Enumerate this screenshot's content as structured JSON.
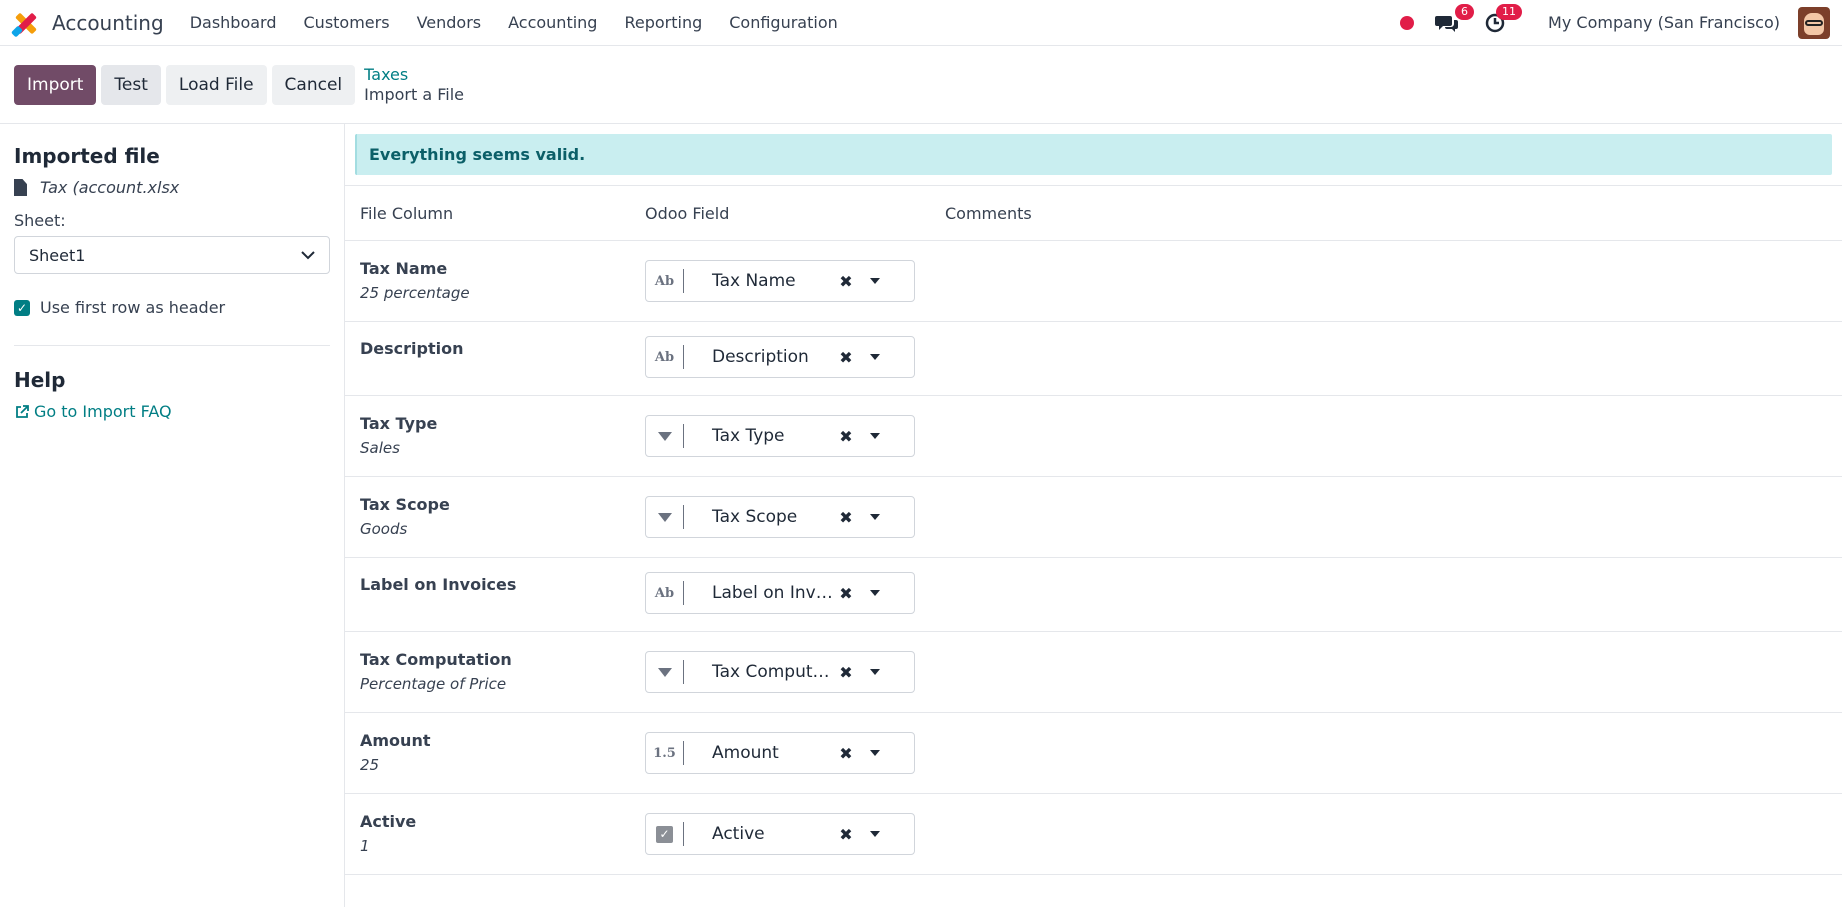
{
  "navbar": {
    "app_name": "Accounting",
    "menu": [
      "Dashboard",
      "Customers",
      "Vendors",
      "Accounting",
      "Reporting",
      "Configuration"
    ],
    "messages_count": "6",
    "activities_count": "11",
    "company": "My Company (San Francisco)"
  },
  "control": {
    "import_label": "Import",
    "test_label": "Test",
    "load_file_label": "Load File",
    "cancel_label": "Cancel",
    "breadcrumb_parent": "Taxes",
    "breadcrumb_current": "Import a File"
  },
  "sidebar": {
    "imported_file_title": "Imported file",
    "file_name": "Tax (account.xlsx",
    "sheet_label": "Sheet:",
    "sheet_value": "Sheet1",
    "header_checkbox_label": "Use first row as header",
    "help_title": "Help",
    "faq_link": "Go to Import FAQ"
  },
  "alert": {
    "message": "Everything seems valid."
  },
  "table": {
    "headers": [
      "File Column",
      "Odoo Field",
      "Comments"
    ],
    "rows": [
      {
        "column": "Tax Name",
        "sample": "25 percentage",
        "type": "text",
        "field": "Tax Name"
      },
      {
        "column": "Description",
        "sample": "",
        "type": "text",
        "field": "Description"
      },
      {
        "column": "Tax Type",
        "sample": "Sales",
        "type": "selection",
        "field": "Tax Type"
      },
      {
        "column": "Tax Scope",
        "sample": "Goods",
        "type": "selection",
        "field": "Tax Scope"
      },
      {
        "column": "Label on Invoices",
        "sample": "",
        "type": "text",
        "field": "Label on Invo..."
      },
      {
        "column": "Tax Computation",
        "sample": "Percentage of Price",
        "type": "selection",
        "field": "Tax Computa..."
      },
      {
        "column": "Amount",
        "sample": "25",
        "type": "float",
        "field": "Amount"
      },
      {
        "column": "Active",
        "sample": "1",
        "type": "boolean",
        "field": "Active"
      }
    ]
  },
  "colors": {
    "primary": "#714b67",
    "link": "#017e84",
    "alert_bg": "#c9eef0",
    "badge": "#e11d48"
  }
}
